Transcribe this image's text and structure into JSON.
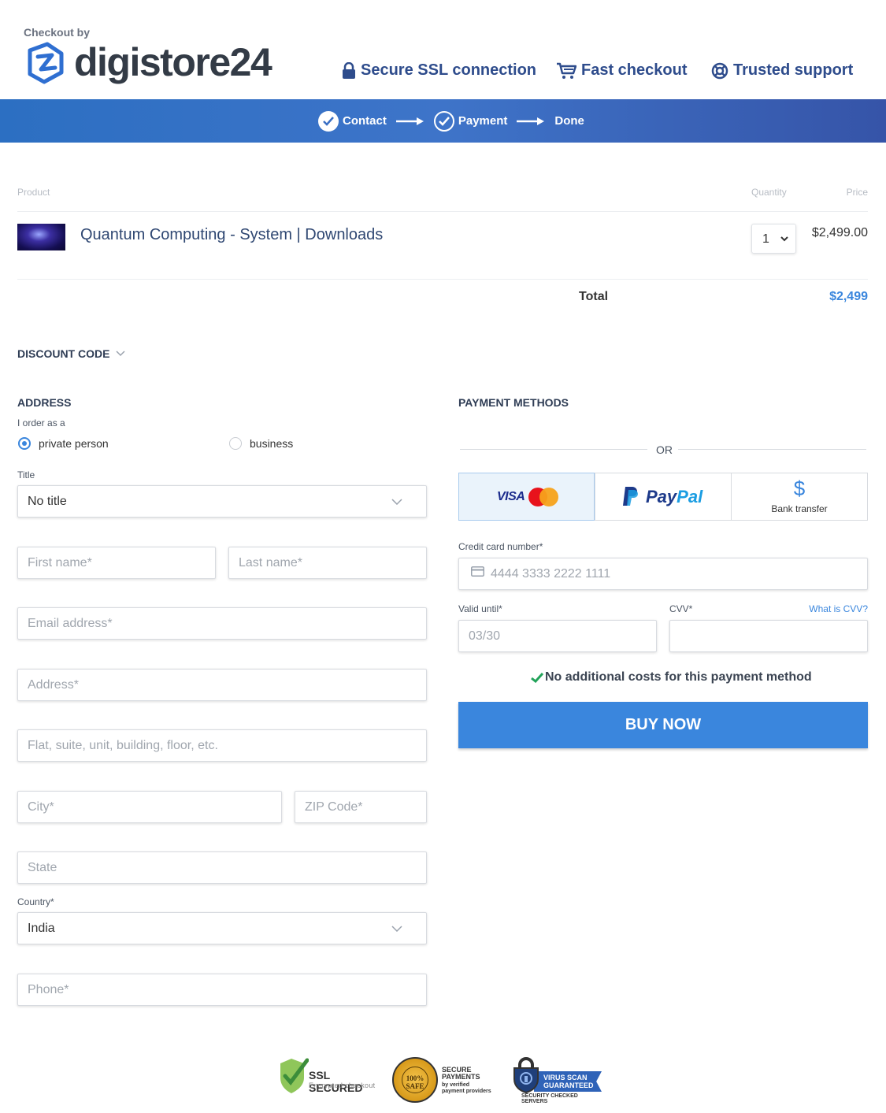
{
  "header": {
    "brand_prefix": "Checkout by",
    "brand_name": "digistore24",
    "features": [
      {
        "icon": "lock-icon",
        "label": "Secure SSL connection"
      },
      {
        "icon": "cart-icon",
        "label": "Fast checkout"
      },
      {
        "icon": "lifebuoy-icon",
        "label": "Trusted support"
      }
    ]
  },
  "steps": [
    {
      "label": "Contact",
      "state": "done"
    },
    {
      "label": "Payment",
      "state": "current"
    },
    {
      "label": "Done",
      "state": "pending"
    }
  ],
  "product_table": {
    "headers": {
      "product": "Product",
      "quantity": "Quantity",
      "price": "Price"
    },
    "item": {
      "name": "Quantum Computing - System | Downloads",
      "quantity": "1",
      "price": "$2,499.00"
    },
    "total_label": "Total",
    "total_value": "$2,499"
  },
  "discount": {
    "label": "DISCOUNT CODE"
  },
  "address": {
    "title": "ADDRESS",
    "order_as_label": "I order as a",
    "options": [
      {
        "label": "private person",
        "selected": true
      },
      {
        "label": "business",
        "selected": false
      }
    ],
    "title_field_label": "Title",
    "title_value": "No title",
    "first_name_placeholder": "First name*",
    "last_name_placeholder": "Last name*",
    "email_placeholder": "Email address*",
    "address_placeholder": "Address*",
    "address2_placeholder": "Flat, suite, unit, building, floor, etc.",
    "city_placeholder": "City*",
    "zip_placeholder": "ZIP Code*",
    "state_placeholder": "State",
    "country_label": "Country*",
    "country_value": "India",
    "phone_placeholder": "Phone*"
  },
  "payment": {
    "title": "PAYMENT METHODS",
    "or_label": "OR",
    "methods": [
      {
        "id": "card",
        "label": "VISA",
        "active": true
      },
      {
        "id": "paypal",
        "label_a": "Pay",
        "label_b": "Pal",
        "active": false
      },
      {
        "id": "bank",
        "icon": "$",
        "label": "Bank transfer",
        "active": false
      }
    ],
    "cc_label": "Credit card number*",
    "cc_placeholder": "4444 3333 2222 1111",
    "valid_label": "Valid until*",
    "valid_placeholder": "03/30",
    "cvv_label": "CVV*",
    "cvv_link": "What is CVV?",
    "no_costs": "No additional costs for this payment method",
    "buy_label": "BUY NOW"
  },
  "badges": {
    "ssl_title": "SSL SECURED",
    "ssl_sub": "Encrypted checkout",
    "seal_text": "100% SAFE",
    "pay_title_1": "SECURE",
    "pay_title_2": "PAYMENTS",
    "pay_sub_1": "by verified",
    "pay_sub_2": "payment providers",
    "virus_1": "VIRUS SCAN",
    "virus_2": "GUARANTEED",
    "virus_sub": "SECURITY CHECKED SERVERS"
  },
  "colors": {
    "accent": "#3a86dd",
    "bar_start": "#2c6fc2",
    "bar_end": "#3654a8",
    "brand_blue": "#2e4c8c"
  }
}
